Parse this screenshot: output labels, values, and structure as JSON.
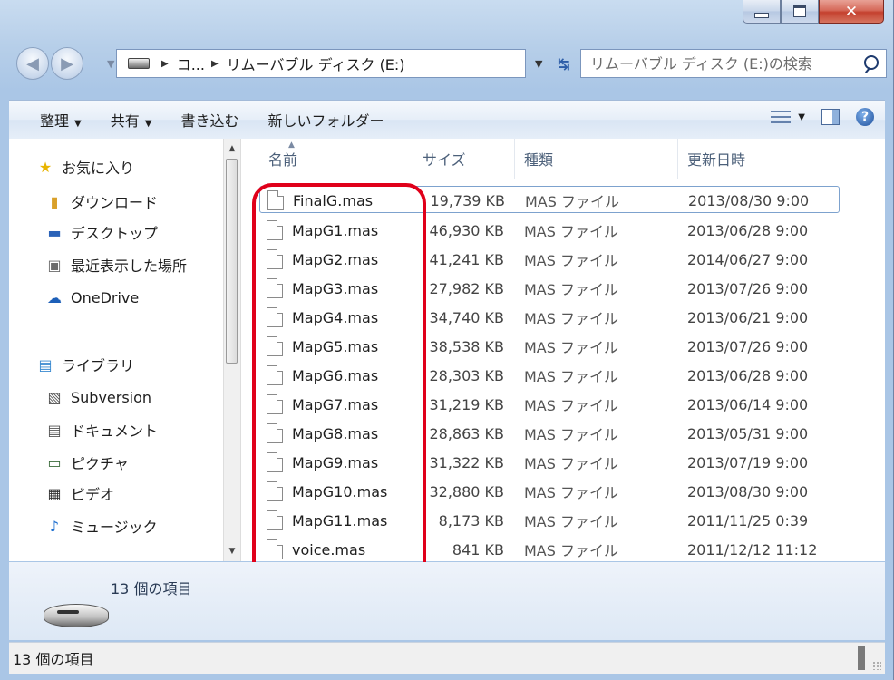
{
  "address_bar": {
    "crumbs": [
      "コ...",
      "リムーバブル ディスク (E:)"
    ],
    "search_placeholder": "リムーバブル ディスク (E:)の検索"
  },
  "toolbar": {
    "organize": "整理",
    "share": "共有",
    "burn": "書き込む",
    "new_folder": "新しいフォルダー"
  },
  "nav": {
    "favorites": "お気に入り",
    "downloads": "ダウンロード",
    "desktop": "デスクトップ",
    "recent": "最近表示した場所",
    "onedrive": "OneDrive",
    "libraries": "ライブラリ",
    "subversion": "Subversion",
    "documents": "ドキュメント",
    "pictures": "ピクチャ",
    "videos": "ビデオ",
    "music": "ミュージック"
  },
  "columns": {
    "name": "名前",
    "size": "サイズ",
    "type": "種類",
    "modified": "更新日時"
  },
  "files": [
    {
      "name": "FinalG.mas",
      "size": "19,739 KB",
      "type": "MAS ファイル",
      "date": "2013/08/30 9:00"
    },
    {
      "name": "MapG1.mas",
      "size": "46,930 KB",
      "type": "MAS ファイル",
      "date": "2013/06/28 9:00"
    },
    {
      "name": "MapG2.mas",
      "size": "41,241 KB",
      "type": "MAS ファイル",
      "date": "2014/06/27 9:00"
    },
    {
      "name": "MapG3.mas",
      "size": "27,982 KB",
      "type": "MAS ファイル",
      "date": "2013/07/26 9:00"
    },
    {
      "name": "MapG4.mas",
      "size": "34,740 KB",
      "type": "MAS ファイル",
      "date": "2013/06/21 9:00"
    },
    {
      "name": "MapG5.mas",
      "size": "38,538 KB",
      "type": "MAS ファイル",
      "date": "2013/07/26 9:00"
    },
    {
      "name": "MapG6.mas",
      "size": "28,303 KB",
      "type": "MAS ファイル",
      "date": "2013/06/28 9:00"
    },
    {
      "name": "MapG7.mas",
      "size": "31,219 KB",
      "type": "MAS ファイル",
      "date": "2013/06/14 9:00"
    },
    {
      "name": "MapG8.mas",
      "size": "28,863 KB",
      "type": "MAS ファイル",
      "date": "2013/05/31 9:00"
    },
    {
      "name": "MapG9.mas",
      "size": "31,322 KB",
      "type": "MAS ファイル",
      "date": "2013/07/19 9:00"
    },
    {
      "name": "MapG10.mas",
      "size": "32,880 KB",
      "type": "MAS ファイル",
      "date": "2013/08/30 9:00"
    },
    {
      "name": "MapG11.mas",
      "size": "8,173 KB",
      "type": "MAS ファイル",
      "date": "2011/11/25 0:39"
    },
    {
      "name": "voice.mas",
      "size": "841 KB",
      "type": "MAS ファイル",
      "date": "2011/12/12 11:12"
    }
  ],
  "details": {
    "count": "13 個の項目"
  },
  "status": {
    "text": "13 個の項目"
  },
  "colors": {
    "highlight": "#e0001a",
    "window_frame": "#b7cfe9"
  }
}
